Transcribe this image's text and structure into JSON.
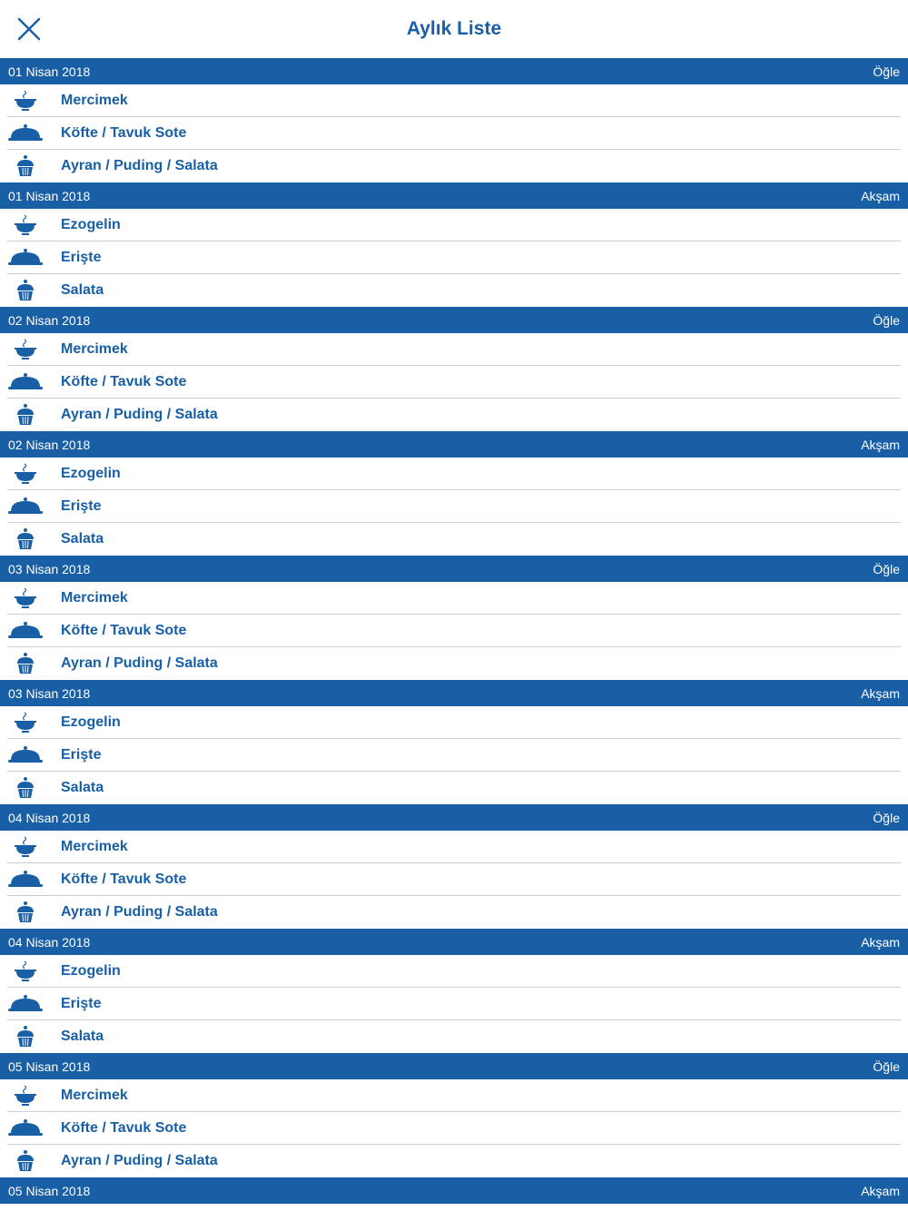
{
  "app": {
    "title": "Aylık Liste",
    "accent_color": "#185fa5",
    "battery_color": "#3ecf4a"
  },
  "nav": {
    "close_icon": "close-icon"
  },
  "sections": [
    {
      "date": "01 Nisan 2018",
      "meal": "Öğle",
      "items": [
        {
          "icon": "soup-bowl-icon",
          "label": "Mercimek"
        },
        {
          "icon": "serving-dish-icon",
          "label": "Köfte / Tavuk Sote"
        },
        {
          "icon": "cupcake-icon",
          "label": "Ayran / Puding / Salata"
        }
      ]
    },
    {
      "date": "01 Nisan 2018",
      "meal": "Akşam",
      "items": [
        {
          "icon": "soup-bowl-icon",
          "label": "Ezogelin"
        },
        {
          "icon": "serving-dish-icon",
          "label": "Erişte"
        },
        {
          "icon": "cupcake-icon",
          "label": "Salata"
        }
      ]
    },
    {
      "date": "02 Nisan 2018",
      "meal": "Öğle",
      "items": [
        {
          "icon": "soup-bowl-icon",
          "label": "Mercimek"
        },
        {
          "icon": "serving-dish-icon",
          "label": "Köfte / Tavuk Sote"
        },
        {
          "icon": "cupcake-icon",
          "label": "Ayran / Puding / Salata"
        }
      ]
    },
    {
      "date": "02 Nisan 2018",
      "meal": "Akşam",
      "items": [
        {
          "icon": "soup-bowl-icon",
          "label": "Ezogelin"
        },
        {
          "icon": "serving-dish-icon",
          "label": "Erişte"
        },
        {
          "icon": "cupcake-icon",
          "label": "Salata"
        }
      ]
    },
    {
      "date": "03 Nisan 2018",
      "meal": "Öğle",
      "items": [
        {
          "icon": "soup-bowl-icon",
          "label": "Mercimek"
        },
        {
          "icon": "serving-dish-icon",
          "label": "Köfte / Tavuk Sote"
        },
        {
          "icon": "cupcake-icon",
          "label": "Ayran / Puding / Salata"
        }
      ]
    },
    {
      "date": "03 Nisan 2018",
      "meal": "Akşam",
      "items": [
        {
          "icon": "soup-bowl-icon",
          "label": "Ezogelin"
        },
        {
          "icon": "serving-dish-icon",
          "label": "Erişte"
        },
        {
          "icon": "cupcake-icon",
          "label": "Salata"
        }
      ]
    },
    {
      "date": "04 Nisan 2018",
      "meal": "Öğle",
      "items": [
        {
          "icon": "soup-bowl-icon",
          "label": "Mercimek"
        },
        {
          "icon": "serving-dish-icon",
          "label": "Köfte / Tavuk Sote"
        },
        {
          "icon": "cupcake-icon",
          "label": "Ayran / Puding / Salata"
        }
      ]
    },
    {
      "date": "04 Nisan 2018",
      "meal": "Akşam",
      "items": [
        {
          "icon": "soup-bowl-icon",
          "label": "Ezogelin"
        },
        {
          "icon": "serving-dish-icon",
          "label": "Erişte"
        },
        {
          "icon": "cupcake-icon",
          "label": "Salata"
        }
      ]
    },
    {
      "date": "05 Nisan 2018",
      "meal": "Öğle",
      "items": [
        {
          "icon": "soup-bowl-icon",
          "label": "Mercimek"
        },
        {
          "icon": "serving-dish-icon",
          "label": "Köfte / Tavuk Sote"
        },
        {
          "icon": "cupcake-icon",
          "label": "Ayran / Puding / Salata"
        }
      ]
    },
    {
      "date": "05 Nisan 2018",
      "meal": "Akşam",
      "items": []
    }
  ]
}
